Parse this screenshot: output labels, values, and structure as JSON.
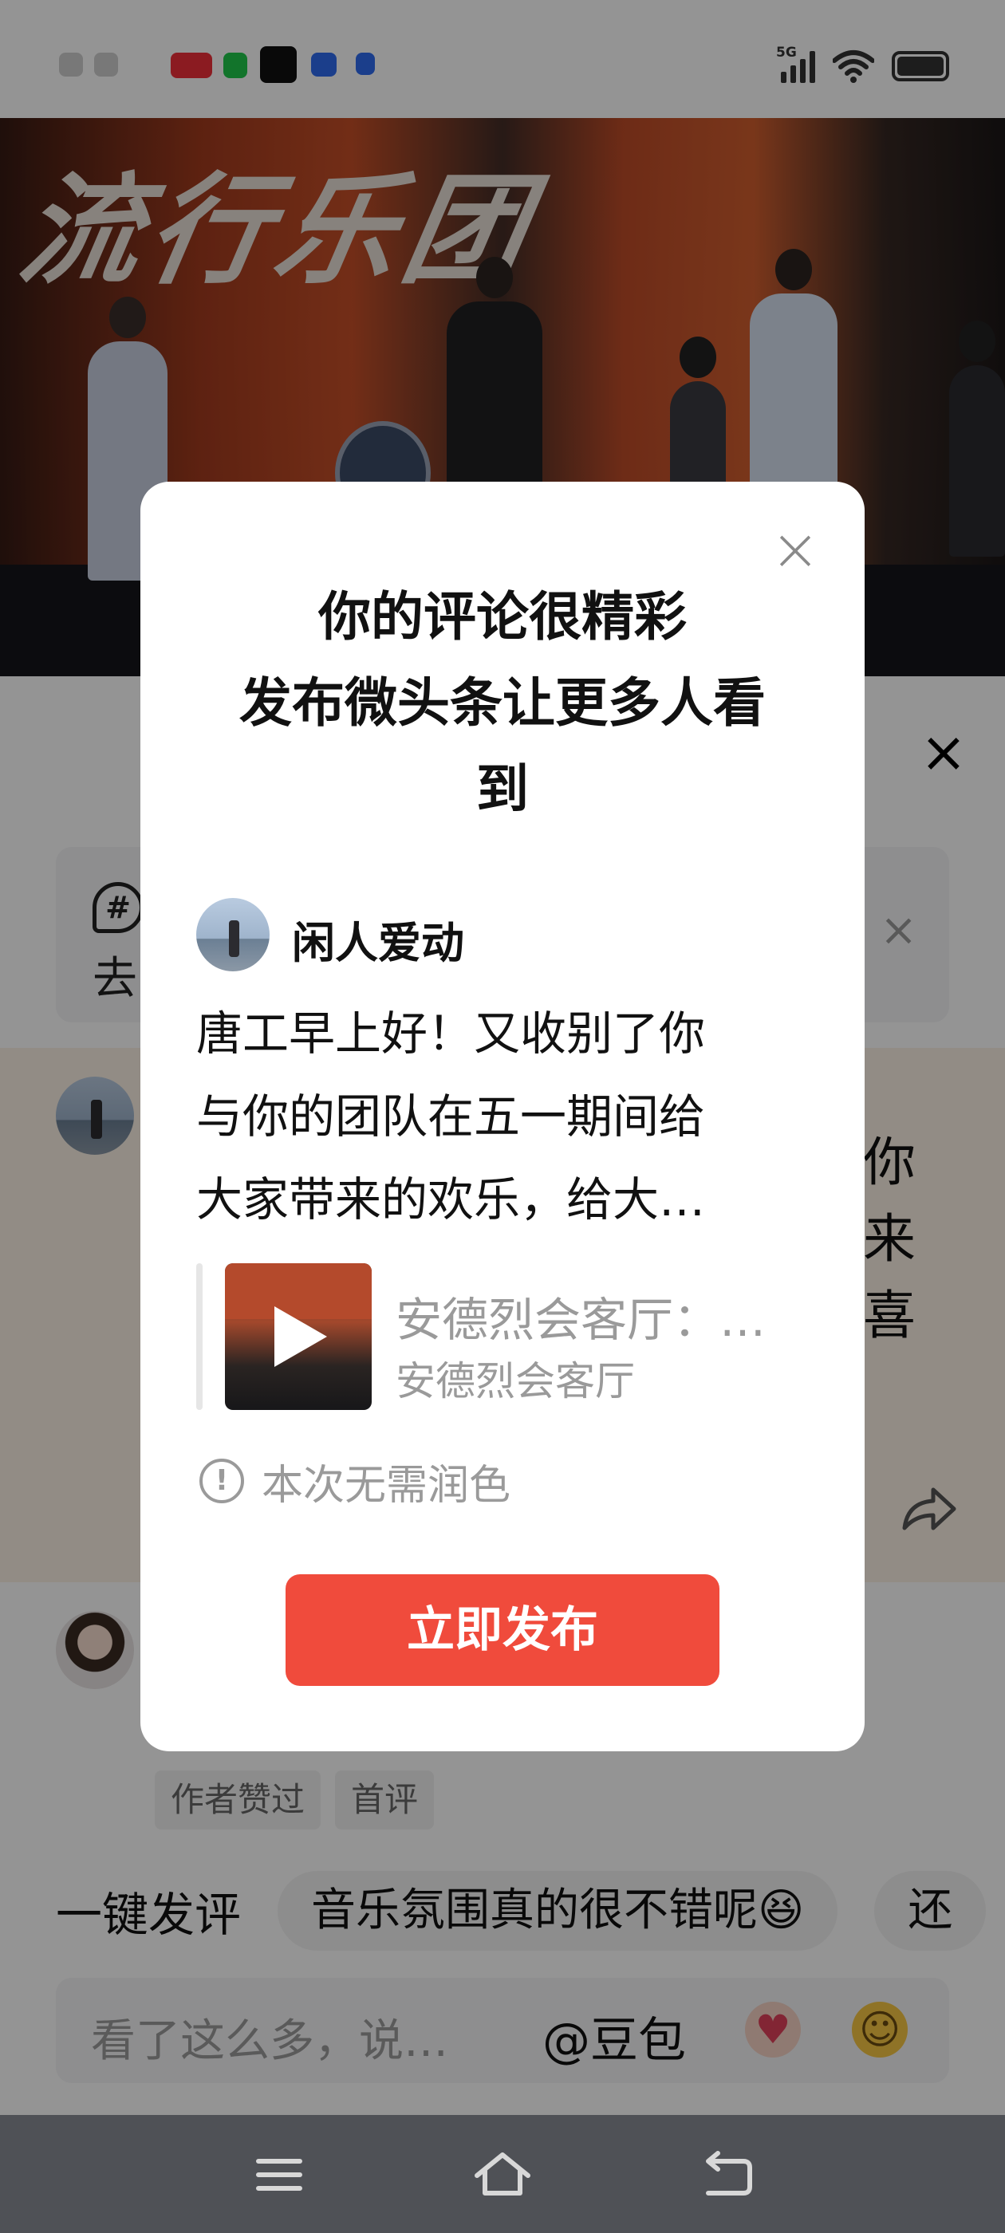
{
  "video": {
    "stage_title": "流行乐团"
  },
  "sheet": {
    "topic_text": "去",
    "comment_side_lines": [
      "你",
      "来",
      "喜"
    ],
    "tags": [
      "作者赞过",
      "首评"
    ],
    "quick_comment": {
      "label": "一键发评",
      "chips": [
        "音乐氛围真的很不错呢😆",
        "还"
      ]
    },
    "input": {
      "placeholder": "看了这么多，说…",
      "mention": "@豆包"
    }
  },
  "modal": {
    "title_lines": [
      "你的评论很精彩",
      "发布微头条让更多人看",
      "到"
    ],
    "user_name": "闲人爱动",
    "body_lines": [
      "唐工早上好！又收别了你",
      "与你的团队在五一期间给",
      "大家带来的欢乐，给大…"
    ],
    "link_card": {
      "title": "安德烈会客厅：…",
      "subtitle": "安德烈会客厅"
    },
    "notice": "本次无需润色",
    "publish_label": "立即发布"
  },
  "status_bar": {
    "network": "5G"
  },
  "colors": {
    "accent": "#f04b3c",
    "overlay": "rgba(0,0,0,0.42)",
    "nav_bar": "#4f5156",
    "comment_highlight": "#fbf2e6"
  }
}
